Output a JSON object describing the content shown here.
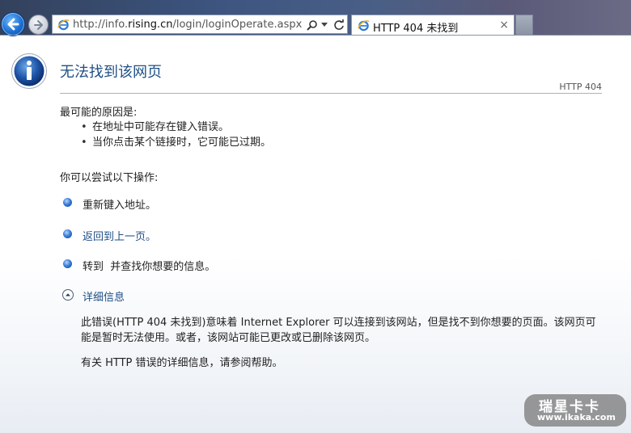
{
  "browser": {
    "address": {
      "prefix": "http://info.",
      "domain": "rising.cn",
      "path": "/login/loginOperate.aspx"
    },
    "tab": {
      "title": "HTTP 404 未找到",
      "close": "×"
    }
  },
  "page": {
    "title": "无法找到该网页",
    "error_code": "HTTP 404",
    "causes_label": "最可能的原因是:",
    "causes": [
      "在地址中可能存在键入错误。",
      "当你点击某个链接时，它可能已过期。"
    ],
    "actions_label": "你可以尝试以下操作:",
    "actions": [
      {
        "text": "重新键入地址。"
      },
      {
        "text": "返回到上一页。"
      },
      {
        "text": "转到  并查找你想要的信息。"
      }
    ],
    "details_label": "详细信息",
    "details_text": "此错误(HTTP 404 未找到)意味着 Internet Explorer 可以连接到该网站，但是找不到你想要的页面。该网页可能是暂时无法使用。或者，该网站可能已更改或已删除该网页。",
    "help_text": "有关 HTTP 错误的详细信息，请参阅帮助。"
  },
  "watermark": {
    "brand": "瑞星卡卡",
    "url": "www.ikaka.com"
  },
  "colors": {
    "link": "#1f4f85",
    "back_button": "#1c6fd1"
  }
}
